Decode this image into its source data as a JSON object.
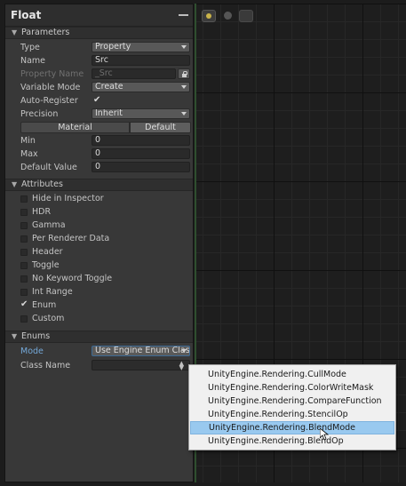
{
  "panel": {
    "title": "Float",
    "sections": {
      "parameters": "Parameters",
      "attributes": "Attributes",
      "enums": "Enums"
    },
    "fields": {
      "type": {
        "label": "Type",
        "value": "Property"
      },
      "name": {
        "label": "Name",
        "value": "Src"
      },
      "property_name": {
        "label": "Property Name",
        "value": "_Src"
      },
      "variable_mode": {
        "label": "Variable Mode",
        "value": "Create"
      },
      "auto_register": {
        "label": "Auto-Register",
        "value": "✔"
      },
      "precision": {
        "label": "Precision",
        "value": "Inherit"
      },
      "material_tab": "Material",
      "default_tab": "Default",
      "min": {
        "label": "Min",
        "value": "0"
      },
      "max": {
        "label": "Max",
        "value": "0"
      },
      "default_value": {
        "label": "Default Value",
        "value": "0"
      }
    },
    "attributes": [
      {
        "label": "Hide in Inspector",
        "checked": false
      },
      {
        "label": "HDR",
        "checked": false
      },
      {
        "label": "Gamma",
        "checked": false
      },
      {
        "label": "Per Renderer Data",
        "checked": false
      },
      {
        "label": "Header",
        "checked": false
      },
      {
        "label": "Toggle",
        "checked": false
      },
      {
        "label": "No Keyword Toggle",
        "checked": false
      },
      {
        "label": "Int Range",
        "checked": false
      },
      {
        "label": "Enum",
        "checked": true,
        "mark": "✔"
      },
      {
        "label": "Custom",
        "checked": false
      }
    ],
    "enums": {
      "mode": {
        "label": "Mode",
        "value": "Use Engine Enum Clas"
      },
      "class_name": {
        "label": "Class Name",
        "value": ""
      }
    }
  },
  "menu": {
    "items": [
      "UnityEngine.Rendering.CullMode",
      "UnityEngine.Rendering.ColorWriteMask",
      "UnityEngine.Rendering.CompareFunction",
      "UnityEngine.Rendering.StencilOp",
      "UnityEngine.Rendering.BlendMode",
      "UnityEngine.Rendering.BlendOp"
    ],
    "selected_index": 4
  },
  "colors": {
    "panel_bg": "#383838",
    "graph_bg": "#1e1e1e",
    "menu_highlight": "#99c9ef",
    "mode_label": "#74a8d8"
  },
  "icons": [
    "minimize-icon",
    "collapse-arrow-icon",
    "lock-icon",
    "dropdown-caret-icon",
    "stepper-icon",
    "mouse-cursor-icon"
  ]
}
